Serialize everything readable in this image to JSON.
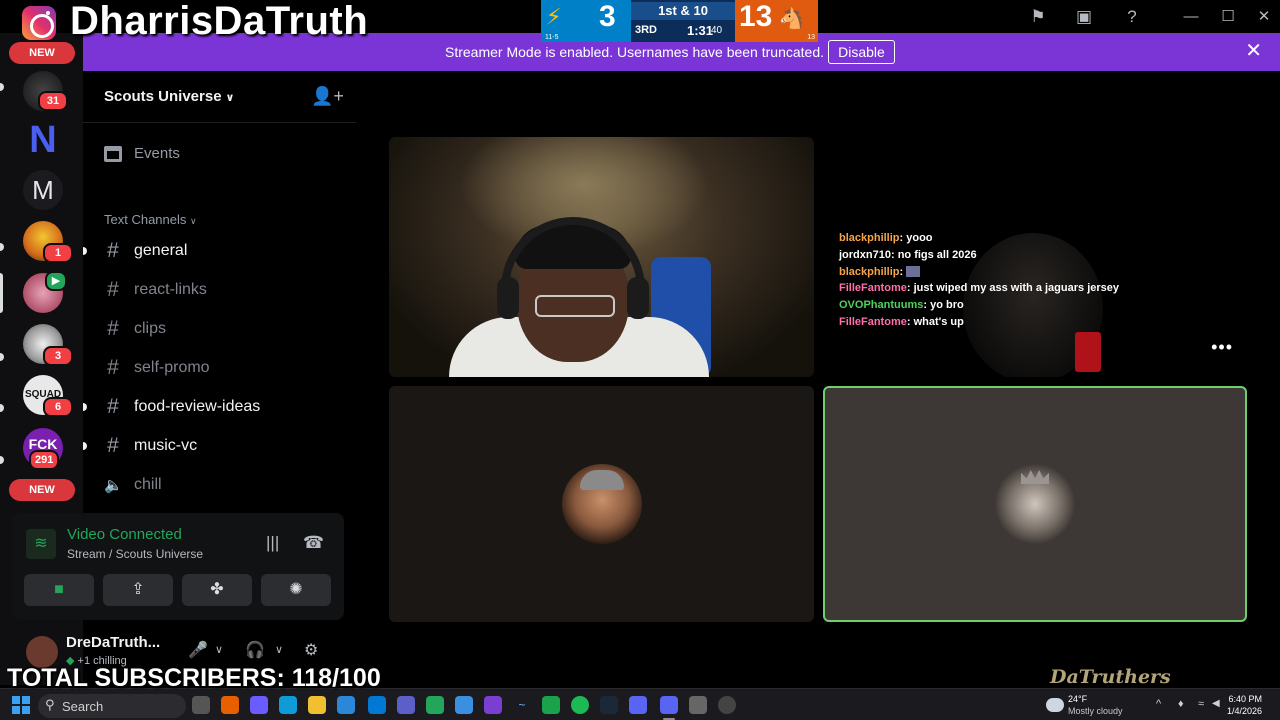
{
  "overlay": {
    "streamer_name": "DharrisDaTruth",
    "subscribers": "TOTAL SUBSCRIBERS: 118/100",
    "watermark": "DaTruthers",
    "scoreboard": {
      "team1_score": "3",
      "team1_record": "11-5",
      "down_distance": "1st & 10",
      "quarter": "3RD",
      "clock": "1:31",
      "play_clock": "40",
      "team2_score": "13",
      "team2_record": "13",
      "team1_color": "#0080c6",
      "team2_color": "#e05a10"
    }
  },
  "banner": {
    "message": "Streamer Mode is enabled. Usernames have been truncated.",
    "button_label": "Disable",
    "close_glyph": "✕",
    "color": "#7b35d6"
  },
  "window": {
    "icons": [
      "flag-icon",
      "inbox-icon",
      "help-icon"
    ],
    "minimize": "—",
    "maximize": "☐",
    "close": "✕"
  },
  "servers": {
    "new_label_top": "NEW",
    "new_label_bottom": "NEW",
    "badges": [
      "31",
      "1",
      "3",
      "6",
      "291"
    ]
  },
  "sidebar": {
    "server_name": "Scouts Universe",
    "events_label": "Events",
    "category_label": "Text Channels",
    "channels": [
      {
        "name": "general"
      },
      {
        "name": "react-links"
      },
      {
        "name": "clips"
      },
      {
        "name": "self-promo"
      },
      {
        "name": "food-review-ideas"
      },
      {
        "name": "music-vc"
      },
      {
        "name": "chill"
      }
    ]
  },
  "voice": {
    "status": "Video Connected",
    "location": "Stream / Scouts Universe"
  },
  "user": {
    "name": "DreDaTruth...",
    "status": "chilling",
    "extra": "+1"
  },
  "chat": [
    {
      "user": "blackphillip",
      "text": "yooo",
      "color": "#f6a34a"
    },
    {
      "user": "jordxn710",
      "text": "no figs all 2026",
      "color": "#ffffff"
    },
    {
      "user": "blackphillip",
      "text": "",
      "color": "#f6a34a"
    },
    {
      "user": "FilleFantome",
      "text": "just wiped my ass with a jaguars jersey",
      "color": "#ff6fa8"
    },
    {
      "user": "OVOPhantuums",
      "text": "yo bro",
      "color": "#4fd15a"
    },
    {
      "user": "FilleFantome",
      "text": "what's up",
      "color": "#ff6fa8"
    }
  ],
  "taskbar": {
    "search_placeholder": "Search",
    "weather_temp": "24°F",
    "weather_desc": "Mostly cloudy",
    "time": "6:40 PM",
    "date": "1/4/2026"
  }
}
